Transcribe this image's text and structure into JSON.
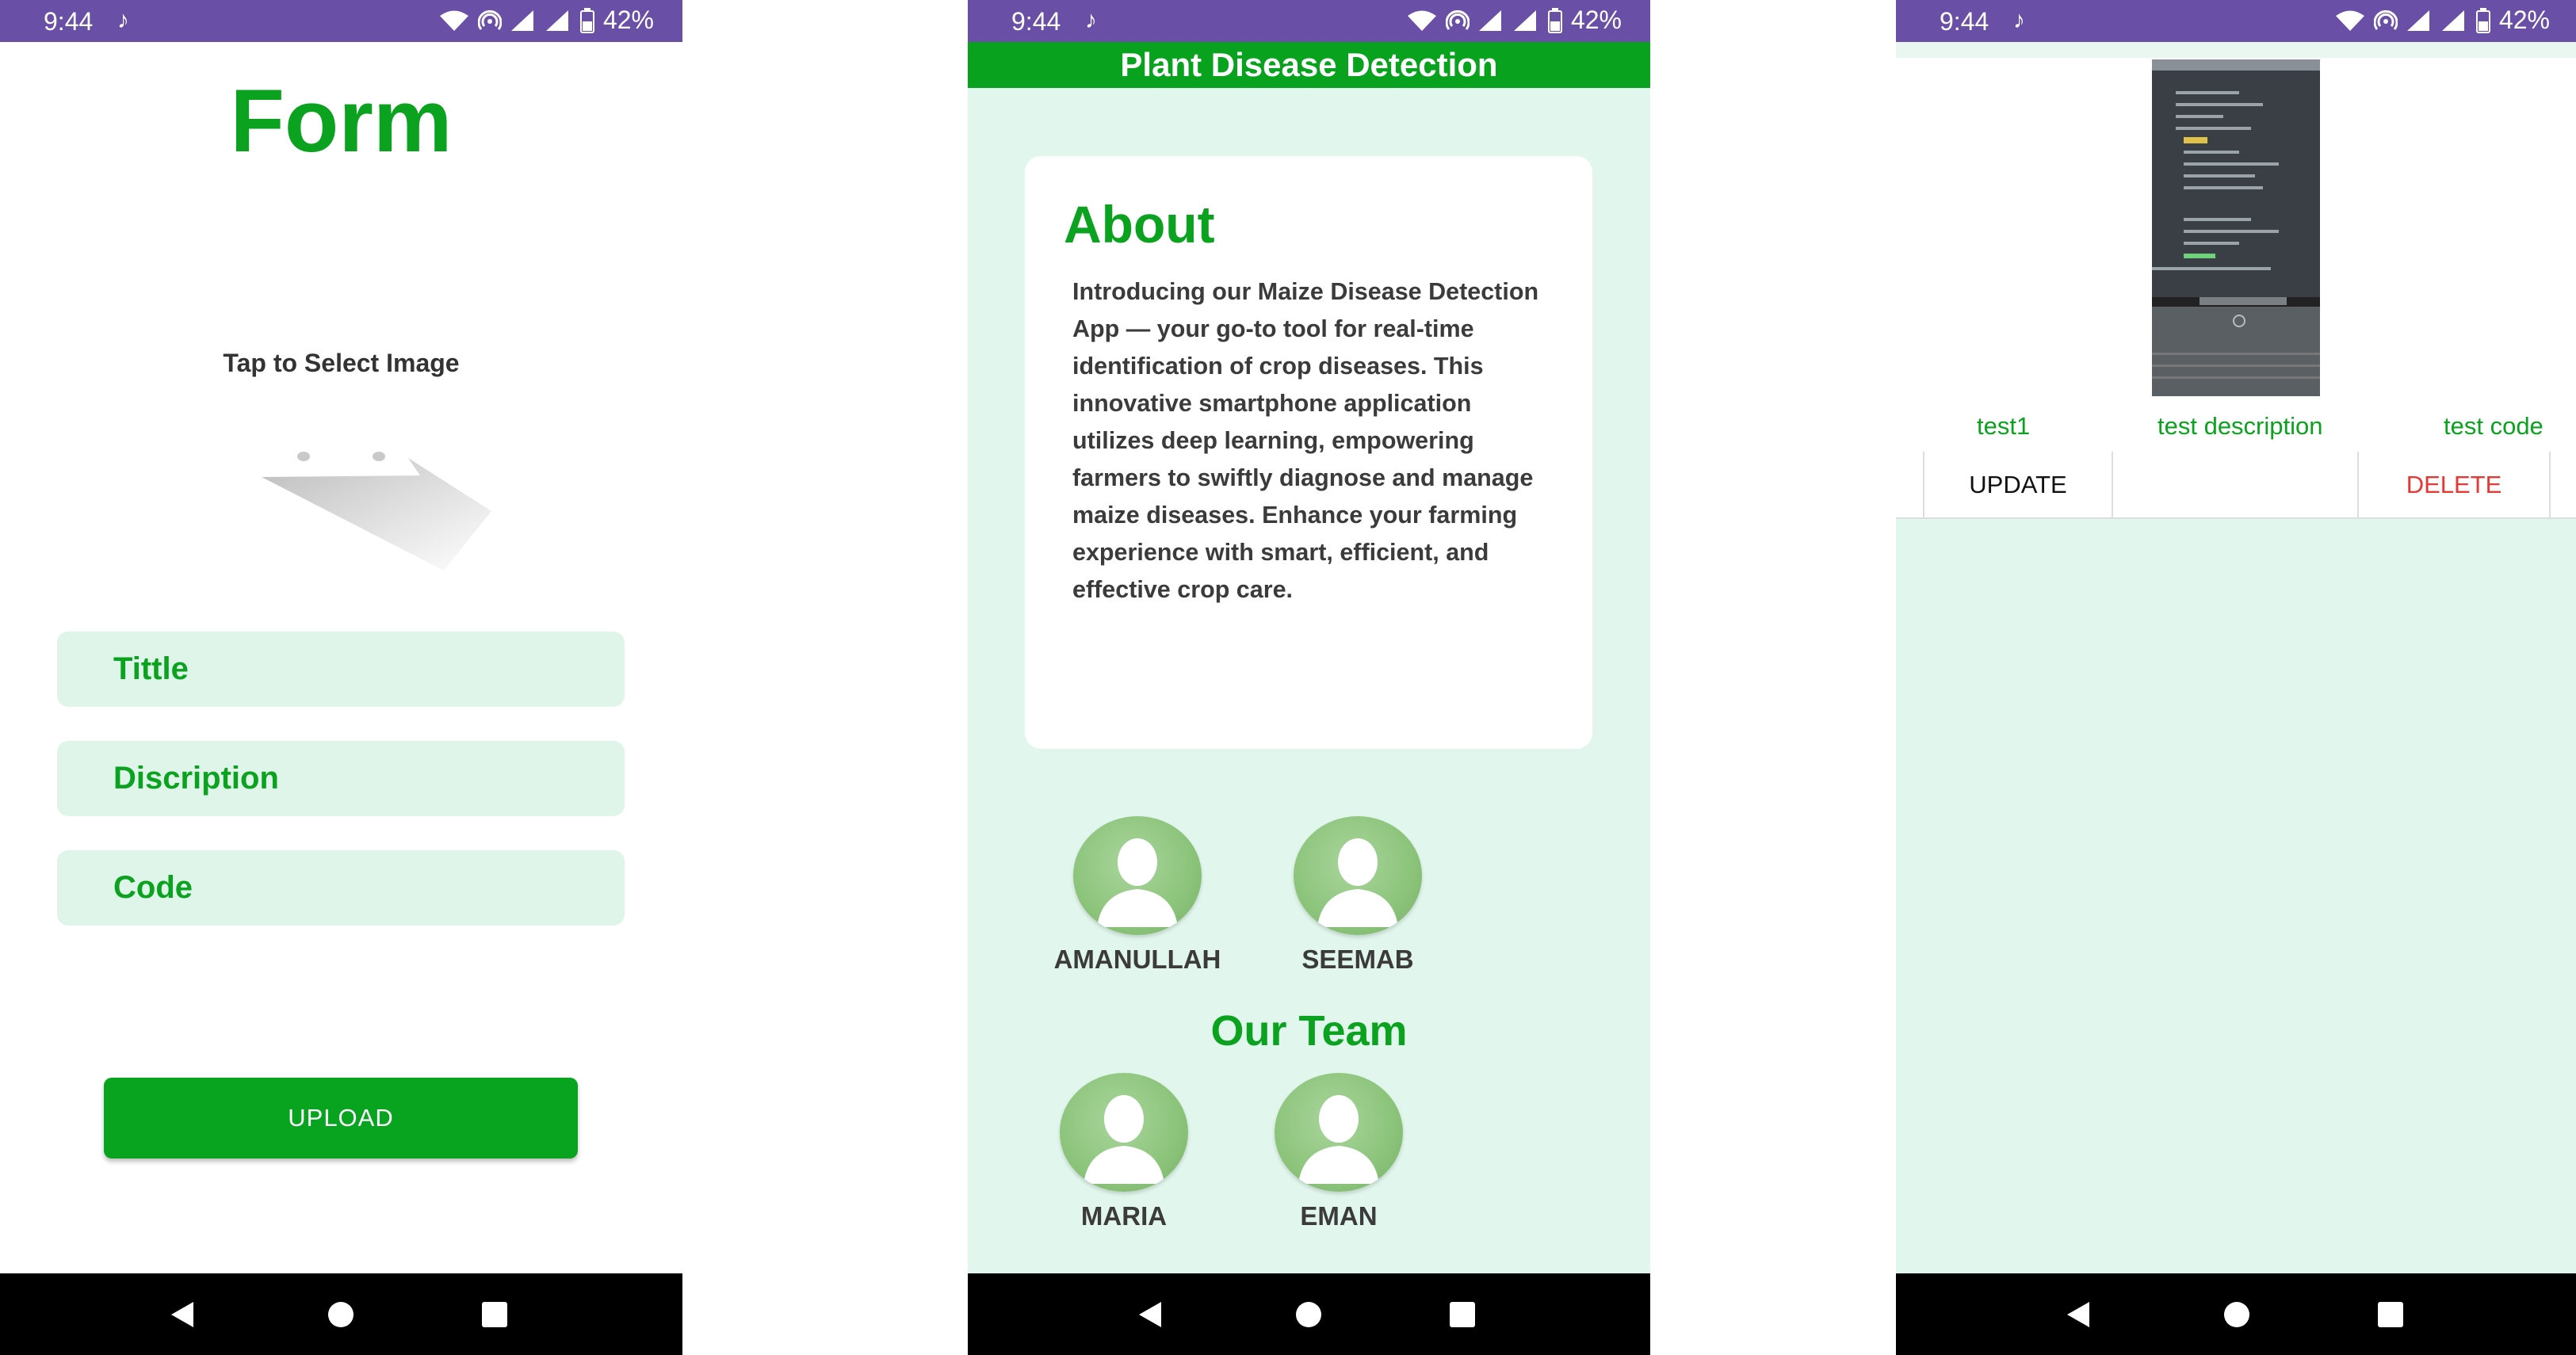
{
  "status_bar": {
    "time": "9:44",
    "battery": "42%"
  },
  "form_screen": {
    "title": "Form",
    "tap_label": "Tap to Select Image",
    "fields": [
      "Tittle",
      "Discription",
      "Code"
    ],
    "upload_label": "UPLOAD"
  },
  "about_screen": {
    "app_bar_title": "Plant Disease Detection",
    "about_title": "About",
    "about_text": "Introducing our Maize Disease Detection App — your go-to tool for real-time identification of crop diseases. This innovative smartphone application utilizes deep learning, empowering farmers to swiftly diagnose and manage maize diseases. Enhance your farming experience with smart, efficient, and effective crop care.",
    "team_title": "Our Team",
    "members": [
      "AMANULLAH",
      "SEEMAB",
      "MARIA",
      "EMAN"
    ]
  },
  "list_screen": {
    "item": {
      "title": "test1",
      "description": "test description",
      "code": "test code"
    },
    "update_label": "UPDATE",
    "delete_label": "DELETE"
  },
  "colors": {
    "accent_green": "#0aa21e",
    "status_purple": "#6a4fa6",
    "mint_bg": "#e1f6ec",
    "delete_red": "#e53935"
  },
  "icons": [
    "tiktok-icon",
    "wifi-icon",
    "hotspot-icon",
    "signal-icon",
    "battery-icon",
    "back-icon",
    "home-icon",
    "recents-icon",
    "avatar-icon"
  ]
}
